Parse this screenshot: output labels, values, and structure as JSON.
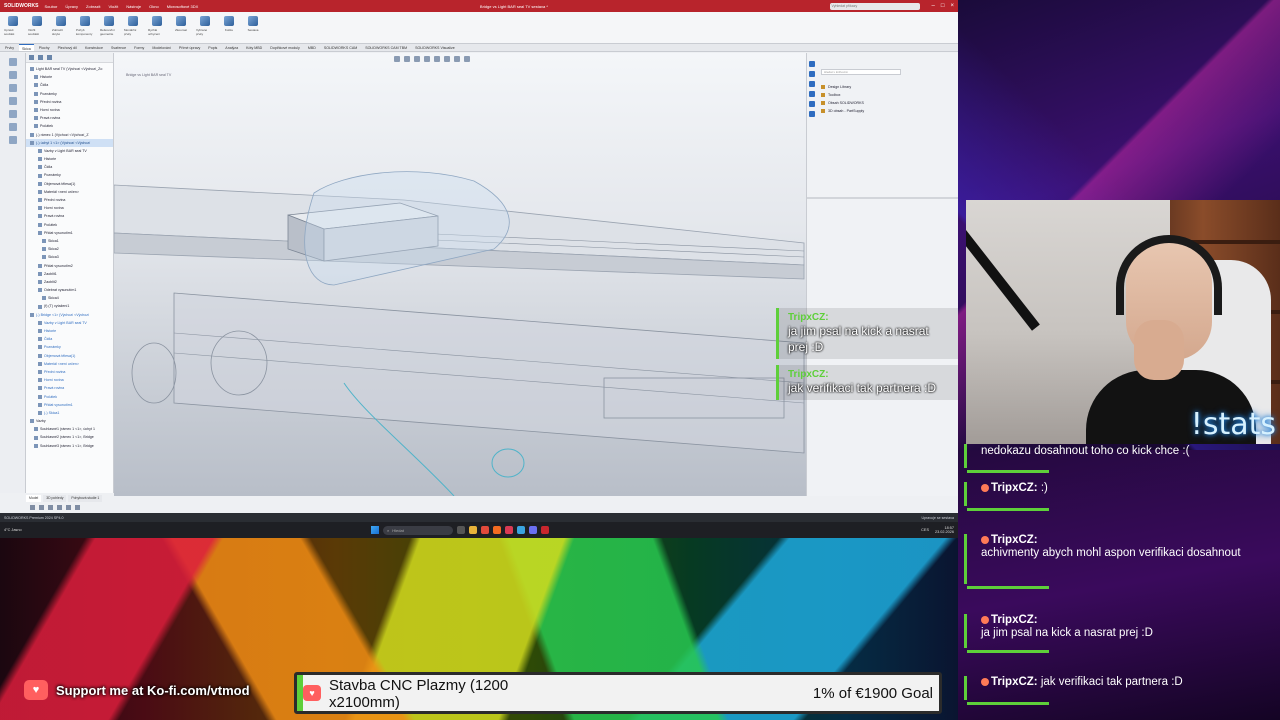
{
  "colors": {
    "sw_red": "#b8242c",
    "accent_green": "#5ecf3a",
    "kofi_red": "#ff5f5f",
    "stats_glow": "#1e7bd2"
  },
  "solidworks": {
    "logo": "SOLIDWORKS",
    "menu": [
      "Soubor",
      "Úpravy",
      "Zobrazit",
      "Vložit",
      "Nástroje",
      "Okno",
      "Microsoftové 3DX"
    ],
    "doc_title": "Bridge vs Light BAR seal TV sestava *",
    "search_placeholder": "Vyhledat příkazy",
    "ribbon_tools": [
      "Upravit součást",
      "Vložit součásti",
      "Zobrazit skryté",
      "Pohyb komponenty",
      "Referenční geometrie",
      "Montážní prvky",
      "Rychlé uchycení",
      "Zkoumat",
      "Vybrané prvky",
      "Kolize",
      "Sestava"
    ],
    "tabs": [
      "Prvky",
      "Skica",
      "Plochy",
      "Plechový díl",
      "Konstrukce",
      "Svařence",
      "Formy",
      "Modelování",
      "Přímé úpravy",
      "Popis",
      "Analýza",
      "Kóty MBD",
      "Doplňkové moduly",
      "MBD",
      "SOLIDWORKS CAM",
      "SOLIDWORKS CAM TBM",
      "SOLIDWORKS Visualize"
    ],
    "active_tab": "Skica",
    "tree_items": [
      "Light BAR seal TV (Výchozí <Výchozí_Zo",
      "Historie",
      "Čidla",
      "Poznámky",
      "Přední rovina",
      "Horní rovina",
      "Pravá rovina",
      "Počátek",
      "(-) rámec 1 (Výchozí <Výchozí_Z",
      "(-) úchyt 1 <1> (Výchozí <Výchozí",
      "Vazby v Light BAR seal TV",
      "Historie",
      "Čidla",
      "Poznámky",
      "Objemová tělesa(1)",
      "Materiál <není určen>",
      "Přední rovina",
      "Horní rovina",
      "Pravá rovina",
      "Počátek",
      "Přidat vysunutím1",
      "Skica1",
      "Skica2",
      "Skica3",
      "Přidat vysunutím2",
      "Zaoblit1",
      "Zaoblit2",
      "Odebrat vysunutím1",
      "Skica4",
      "(f) (T) vytažení1",
      "(-) Bridge <1> (Výchozí <Výchozí",
      "Vazby v Light BAR seal TV",
      "Historie",
      "Čidla",
      "Poznámky",
      "Objemová tělesa(1)",
      "Materiál <není určen>",
      "Přední rovina",
      "Horní rovina",
      "Pravá rovina",
      "Počátek",
      "Přidat vysunutím1",
      "(-) Skica1",
      "Vazby",
      "Souhlasné1 (rámec 1 <1>, úchyt 1",
      "Souhlasné2 (rámec 1 <1>, Bridge",
      "Souhlasné3 (rámec 1 <1>, Bridge"
    ],
    "crumb": "Bridge vs Light BAR seal TV",
    "taskpane_search": "Hledat v knihovně",
    "taskpane_items": [
      "Design Library",
      "Toolbox",
      "Obsah SOLIDWORKS",
      "3D obsah - PartSupply"
    ],
    "bottom_tabs": [
      "Model",
      "3D pohledy",
      "Pohybová studie 1"
    ],
    "status_left": "SOLIDWORKS Premium 2024 SP4.0",
    "status_right": "Upravuje se sestava"
  },
  "taskbar": {
    "weather": "4°C Jasno",
    "search_placeholder": "Hledat",
    "tray_lang": "CES",
    "time": "18:57",
    "date": "23.02.2026"
  },
  "overlay_chat": [
    {
      "user": "TripxCZ:",
      "text": "ja jim psal na kick a nasrat prej :D"
    },
    {
      "user": "TripxCZ:",
      "text": "jak verifikaci tak partnera :D"
    }
  ],
  "webcam": {
    "stats_text": "!stats"
  },
  "chat": [
    {
      "user": "",
      "text": "nedokazu dosahnout toho co kick chce :("
    },
    {
      "user": "TripxCZ:",
      "text": ":)"
    },
    {
      "user": "TripxCZ:",
      "text": "achivmenty abych mohl aspon verifikaci dosahnout"
    },
    {
      "user": "TripxCZ:",
      "text": "ja jim psal na kick a nasrat prej :D"
    },
    {
      "user": "TripxCZ:",
      "text": "jak verifikaci tak partnera :D"
    }
  ],
  "kofi": {
    "text": "Support me at Ko-fi.com/vtmod"
  },
  "goal": {
    "title": "Stavba CNC Plazmy (1200 x2100mm)",
    "amount_text": "1% of €1900 Goal",
    "progress_percent": 1
  }
}
